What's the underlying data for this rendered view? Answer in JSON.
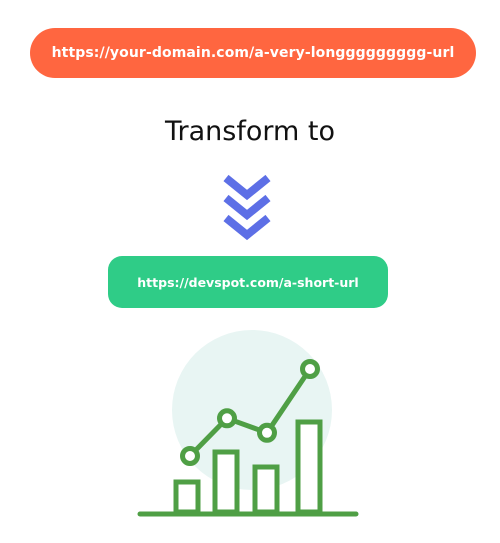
{
  "long_url": "https://your-domain.com/a-very-longgggggggg-url",
  "heading": "Transform to",
  "short_url": "https://devspot.com/a-short-url",
  "icons": {
    "arrows": "triple-chevron-down-icon",
    "chart": "growth-chart-icon"
  },
  "colors": {
    "long_url_bg": "#ff6640",
    "short_url_bg": "#2fcc87",
    "arrow": "#5d6fe6",
    "chart_stroke": "#4f9f45",
    "chart_circle": "#e8f5f3"
  },
  "chart_data": {
    "type": "bar",
    "values": [
      2,
      4,
      3,
      6
    ],
    "trend_line": [
      3,
      4.3,
      3.8,
      6
    ]
  }
}
